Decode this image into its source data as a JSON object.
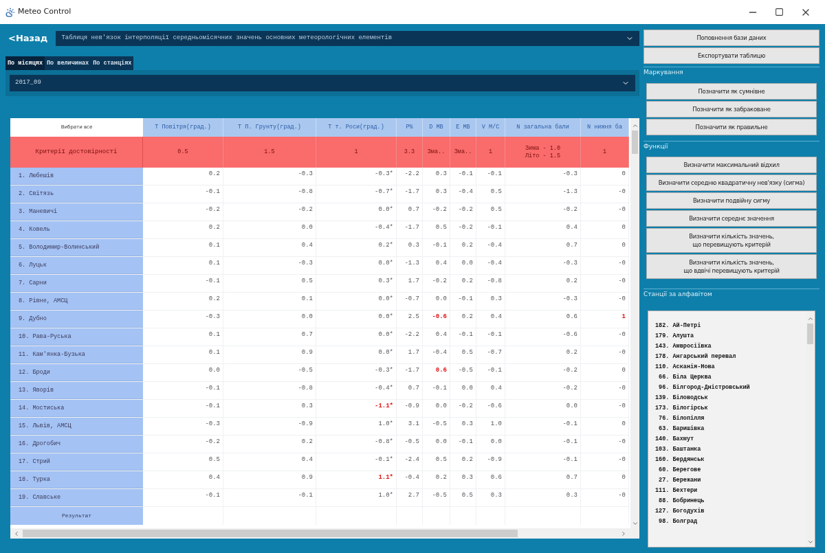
{
  "window": {
    "title": "Meteo Control"
  },
  "back_link": "<Назад",
  "table_select": {
    "value": "Таблиця нев'язок інтерполяції середньомісячних значень основних метеорологічних елементів"
  },
  "tabs": [
    {
      "label": "По місяцях",
      "selected": true
    },
    {
      "label": "По величинах",
      "selected": false
    },
    {
      "label": "По станціях",
      "selected": false
    }
  ],
  "period_select": {
    "value": "2017_09"
  },
  "table": {
    "select_all": "Вибрати все",
    "columns": [
      "Т Повітря(град.)",
      "Т П. Грунту(град.)",
      "Т т. Роси(град.)",
      "P%",
      "D MB",
      "E MB",
      "V M/C",
      "N загальна бали",
      "N нижня ба"
    ],
    "criteria": {
      "label": "Критерії достовірності",
      "cells": [
        [
          "0.5"
        ],
        [
          "1.5"
        ],
        [
          "1"
        ],
        [
          "3.3"
        ],
        [
          "Зма.."
        ],
        [
          "Зма.."
        ],
        [
          "1"
        ],
        [
          "Зима - 1.0",
          "Літо - 1.5"
        ],
        [
          "1"
        ]
      ]
    },
    "rows": [
      {
        "station": "1. Любешів",
        "cells": [
          {
            "text": "0.2",
            "alert": false
          },
          {
            "text": "-0.3",
            "alert": false
          },
          {
            "text": "-0.3*",
            "alert": false
          },
          {
            "text": "-2.2",
            "alert": false
          },
          {
            "text": "0.3",
            "alert": false
          },
          {
            "text": "-0.1",
            "alert": false
          },
          {
            "text": "-0.1",
            "alert": false
          },
          {
            "text": "-0.3",
            "alert": false
          },
          {
            "text": "0",
            "alert": false
          }
        ]
      },
      {
        "station": "2. Світязь",
        "cells": [
          {
            "text": "-0.1",
            "alert": false
          },
          {
            "text": "-0.8",
            "alert": false
          },
          {
            "text": "-0.7*",
            "alert": false
          },
          {
            "text": "-1.7",
            "alert": false
          },
          {
            "text": "0.3",
            "alert": false
          },
          {
            "text": "-0.4",
            "alert": false
          },
          {
            "text": "0.5",
            "alert": false
          },
          {
            "text": "-1.3",
            "alert": false
          },
          {
            "text": "-0",
            "alert": false
          }
        ]
      },
      {
        "station": "3. Маневичі",
        "cells": [
          {
            "text": "-0.2",
            "alert": false
          },
          {
            "text": "-0.2",
            "alert": false
          },
          {
            "text": "0.0*",
            "alert": false
          },
          {
            "text": "0.7",
            "alert": false
          },
          {
            "text": "-0.2",
            "alert": false
          },
          {
            "text": "-0.2",
            "alert": false
          },
          {
            "text": "0.5",
            "alert": false
          },
          {
            "text": "-0.2",
            "alert": false
          },
          {
            "text": "-0",
            "alert": false
          }
        ]
      },
      {
        "station": "4. Ковель",
        "cells": [
          {
            "text": "0.2",
            "alert": false
          },
          {
            "text": "0.0",
            "alert": false
          },
          {
            "text": "-0.4*",
            "alert": false
          },
          {
            "text": "-1.7",
            "alert": false
          },
          {
            "text": "0.5",
            "alert": false
          },
          {
            "text": "-0.2",
            "alert": false
          },
          {
            "text": "-0.1",
            "alert": false
          },
          {
            "text": "0.4",
            "alert": false
          },
          {
            "text": "0",
            "alert": false
          }
        ]
      },
      {
        "station": "5. Володимир-Волинський",
        "cells": [
          {
            "text": "0.1",
            "alert": false
          },
          {
            "text": "0.4",
            "alert": false
          },
          {
            "text": "0.2*",
            "alert": false
          },
          {
            "text": "0.3",
            "alert": false
          },
          {
            "text": "-0.1",
            "alert": false
          },
          {
            "text": "0.2",
            "alert": false
          },
          {
            "text": "-0.4",
            "alert": false
          },
          {
            "text": "0.7",
            "alert": false
          },
          {
            "text": "0",
            "alert": false
          }
        ]
      },
      {
        "station": "6. Луцьк",
        "cells": [
          {
            "text": "0.1",
            "alert": false
          },
          {
            "text": "-0.3",
            "alert": false
          },
          {
            "text": "0.0*",
            "alert": false
          },
          {
            "text": "-1.3",
            "alert": false
          },
          {
            "text": "0.4",
            "alert": false
          },
          {
            "text": "0.0",
            "alert": false
          },
          {
            "text": "-0.4",
            "alert": false
          },
          {
            "text": "-0.3",
            "alert": false
          },
          {
            "text": "-0",
            "alert": false
          }
        ]
      },
      {
        "station": "7. Сарни",
        "cells": [
          {
            "text": "-0.1",
            "alert": false
          },
          {
            "text": "0.5",
            "alert": false
          },
          {
            "text": "0.3*",
            "alert": false
          },
          {
            "text": "1.7",
            "alert": false
          },
          {
            "text": "-0.2",
            "alert": false
          },
          {
            "text": "0.2",
            "alert": false
          },
          {
            "text": "-0.8",
            "alert": false
          },
          {
            "text": "0.2",
            "alert": false
          },
          {
            "text": "-0",
            "alert": false
          }
        ]
      },
      {
        "station": "8. Рівне, АМСЦ",
        "cells": [
          {
            "text": "0.2",
            "alert": false
          },
          {
            "text": "0.1",
            "alert": false
          },
          {
            "text": "0.0*",
            "alert": false
          },
          {
            "text": "-0.7",
            "alert": false
          },
          {
            "text": "0.0",
            "alert": false
          },
          {
            "text": "-0.1",
            "alert": false
          },
          {
            "text": "0.3",
            "alert": false
          },
          {
            "text": "-0.3",
            "alert": false
          },
          {
            "text": "-0",
            "alert": false
          }
        ]
      },
      {
        "station": "9. Дубно",
        "cells": [
          {
            "text": "-0.3",
            "alert": false
          },
          {
            "text": "0.0",
            "alert": false
          },
          {
            "text": "0.0*",
            "alert": false
          },
          {
            "text": "2.5",
            "alert": false
          },
          {
            "text": "-0.6",
            "alert": true
          },
          {
            "text": "0.2",
            "alert": false
          },
          {
            "text": "0.4",
            "alert": false
          },
          {
            "text": "0.6",
            "alert": false
          },
          {
            "text": "1",
            "alert": true
          }
        ]
      },
      {
        "station": "10. Рава-Руська",
        "cells": [
          {
            "text": "0.1",
            "alert": false
          },
          {
            "text": "0.7",
            "alert": false
          },
          {
            "text": "0.0*",
            "alert": false
          },
          {
            "text": "-2.2",
            "alert": false
          },
          {
            "text": "0.4",
            "alert": false
          },
          {
            "text": "-0.1",
            "alert": false
          },
          {
            "text": "-0.1",
            "alert": false
          },
          {
            "text": "-0.6",
            "alert": false
          },
          {
            "text": "-0",
            "alert": false
          }
        ]
      },
      {
        "station": "11. Кам'янка-Бузька",
        "cells": [
          {
            "text": "0.1",
            "alert": false
          },
          {
            "text": "0.9",
            "alert": false
          },
          {
            "text": "0.0*",
            "alert": false
          },
          {
            "text": "1.7",
            "alert": false
          },
          {
            "text": "-0.4",
            "alert": false
          },
          {
            "text": "0.5",
            "alert": false
          },
          {
            "text": "-0.7",
            "alert": false
          },
          {
            "text": "0.2",
            "alert": false
          },
          {
            "text": "-0",
            "alert": false
          }
        ]
      },
      {
        "station": "12. Броди",
        "cells": [
          {
            "text": "0.0",
            "alert": false
          },
          {
            "text": "-0.5",
            "alert": false
          },
          {
            "text": "-0.3*",
            "alert": false
          },
          {
            "text": "-1.7",
            "alert": false
          },
          {
            "text": "0.6",
            "alert": true
          },
          {
            "text": "-0.5",
            "alert": false
          },
          {
            "text": "-0.1",
            "alert": false
          },
          {
            "text": "-0.2",
            "alert": false
          },
          {
            "text": "0",
            "alert": false
          }
        ]
      },
      {
        "station": "13. Яворів",
        "cells": [
          {
            "text": "-0.1",
            "alert": false
          },
          {
            "text": "-0.8",
            "alert": false
          },
          {
            "text": "-0.4*",
            "alert": false
          },
          {
            "text": "0.7",
            "alert": false
          },
          {
            "text": "-0.1",
            "alert": false
          },
          {
            "text": "0.0",
            "alert": false
          },
          {
            "text": "0.4",
            "alert": false
          },
          {
            "text": "-0.2",
            "alert": false
          },
          {
            "text": "-0",
            "alert": false
          }
        ]
      },
      {
        "station": "14. Мостиська",
        "cells": [
          {
            "text": "-0.1",
            "alert": false
          },
          {
            "text": "0.3",
            "alert": false
          },
          {
            "text": "-1.1*",
            "alert": true
          },
          {
            "text": "-0.9",
            "alert": false
          },
          {
            "text": "0.0",
            "alert": false
          },
          {
            "text": "-0.2",
            "alert": false
          },
          {
            "text": "-0.6",
            "alert": false
          },
          {
            "text": "0.0",
            "alert": false
          },
          {
            "text": "-0",
            "alert": false
          }
        ]
      },
      {
        "station": "15. Львів, АМСЦ",
        "cells": [
          {
            "text": "-0.3",
            "alert": false
          },
          {
            "text": "-0.9",
            "alert": false
          },
          {
            "text": "1.0*",
            "alert": false
          },
          {
            "text": "3.1",
            "alert": false
          },
          {
            "text": "-0.5",
            "alert": false
          },
          {
            "text": "0.3",
            "alert": false
          },
          {
            "text": "1.0",
            "alert": false
          },
          {
            "text": "-0.1",
            "alert": false
          },
          {
            "text": "0",
            "alert": false
          }
        ]
      },
      {
        "station": "16. Дрогобич",
        "cells": [
          {
            "text": "-0.2",
            "alert": false
          },
          {
            "text": "0.2",
            "alert": false
          },
          {
            "text": "-0.8*",
            "alert": false
          },
          {
            "text": "-0.5",
            "alert": false
          },
          {
            "text": "0.0",
            "alert": false
          },
          {
            "text": "-0.1",
            "alert": false
          },
          {
            "text": "0.0",
            "alert": false
          },
          {
            "text": "-0.1",
            "alert": false
          },
          {
            "text": "-0",
            "alert": false
          }
        ]
      },
      {
        "station": "17. Стрий",
        "cells": [
          {
            "text": "0.5",
            "alert": false
          },
          {
            "text": "0.4",
            "alert": false
          },
          {
            "text": "-0.1*",
            "alert": false
          },
          {
            "text": "-2.4",
            "alert": false
          },
          {
            "text": "0.5",
            "alert": false
          },
          {
            "text": "0.2",
            "alert": false
          },
          {
            "text": "-0.9",
            "alert": false
          },
          {
            "text": "-0.1",
            "alert": false
          },
          {
            "text": "-0",
            "alert": false
          }
        ]
      },
      {
        "station": "18. Турка",
        "cells": [
          {
            "text": "0.4",
            "alert": false
          },
          {
            "text": "0.9",
            "alert": false
          },
          {
            "text": "1.1*",
            "alert": true
          },
          {
            "text": "-0.4",
            "alert": false
          },
          {
            "text": "0.2",
            "alert": false
          },
          {
            "text": "0.3",
            "alert": false
          },
          {
            "text": "0.6",
            "alert": false
          },
          {
            "text": "0.7",
            "alert": false
          },
          {
            "text": "0",
            "alert": false
          }
        ]
      },
      {
        "station": "19. Славське",
        "cells": [
          {
            "text": "-0.1",
            "alert": false
          },
          {
            "text": "-0.1",
            "alert": false
          },
          {
            "text": "1.0*",
            "alert": false
          },
          {
            "text": "2.7",
            "alert": false
          },
          {
            "text": "-0.5",
            "alert": false
          },
          {
            "text": "0.5",
            "alert": false
          },
          {
            "text": "0.3",
            "alert": false
          },
          {
            "text": "0.3",
            "alert": false
          },
          {
            "text": "-0",
            "alert": false
          }
        ]
      }
    ],
    "result_label": "Результат"
  },
  "top_buttons": [
    "Поповнення бази даних",
    "Експортувати таблицю"
  ],
  "groups": [
    {
      "title": "Маркування",
      "buttons": [
        [
          "Позначити як сумнівне"
        ],
        [
          "Позначити як забраковане"
        ],
        [
          "Позначити як правильне"
        ]
      ]
    },
    {
      "title": "Функції",
      "buttons": [
        [
          "Визначити максимальний відхил"
        ],
        [
          "Визначити середню квадратичну нев'язку (сигма)"
        ],
        [
          "Визначити подвійну сигму"
        ],
        [
          "Визначити середнє значення"
        ],
        [
          "Визначити кількість значень,",
          "що перевищують критерій"
        ],
        [
          "Визначити кількість значень,",
          "що вдвічі перевищують критерій"
        ]
      ]
    }
  ],
  "stations": {
    "title": "Станції за алфавітом",
    "items": [
      "182. Ай-Петрі",
      "179. Алушта",
      "143. Амвросіївка",
      "178. Ангарський перевал",
      "110. Асканія-Нова",
      " 66. Біла Церква",
      " 96. Білгород-Дністровський",
      "139. Біловодськ",
      "173. Білогірськ",
      " 76. Білопілля",
      " 63. Баришівка",
      "140. Бахмут",
      "103. Баштанка",
      "160. Бердянськ",
      " 60. Берегове",
      " 27. Бережани",
      "111. Бехтери",
      " 88. Бобринець",
      "127. Богодухів",
      " 98. Болград"
    ]
  }
}
